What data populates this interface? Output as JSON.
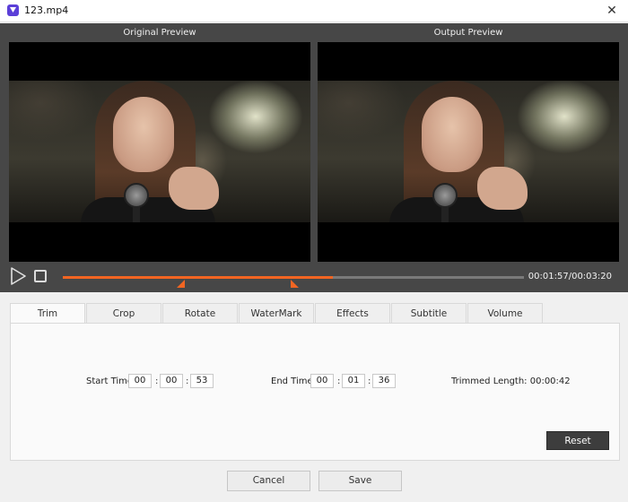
{
  "window": {
    "title": "123.mp4",
    "close_glyph": "✕"
  },
  "preview": {
    "original_label": "Original Preview",
    "output_label": "Output Preview"
  },
  "player": {
    "current_time": "00:01:57",
    "total_time": "00:03:20",
    "timecode": "00:01:57/00:03:20",
    "progress_fraction": 0.585,
    "trim_start_fraction": 0.265,
    "trim_end_fraction": 0.495,
    "accent_color": "#f26522"
  },
  "tabs": [
    {
      "label": "Trim",
      "active": true
    },
    {
      "label": "Crop",
      "active": false
    },
    {
      "label": "Rotate",
      "active": false
    },
    {
      "label": "WaterMark",
      "active": false
    },
    {
      "label": "Effects",
      "active": false
    },
    {
      "label": "Subtitle",
      "active": false
    },
    {
      "label": "Volume",
      "active": false
    }
  ],
  "trim": {
    "start_label": "Start Time:",
    "start": {
      "hh": "00",
      "mm": "00",
      "ss": "53"
    },
    "end_label": "End Time:",
    "end": {
      "hh": "00",
      "mm": "01",
      "ss": "36"
    },
    "separator": ":",
    "trimmed_length_label": "Trimmed Length: 00:00:42",
    "reset_label": "Reset"
  },
  "footer": {
    "cancel_label": "Cancel",
    "save_label": "Save"
  },
  "icons": {
    "app": "app-logo-icon",
    "play": "play-icon",
    "stop": "stop-icon",
    "close": "close-icon"
  }
}
